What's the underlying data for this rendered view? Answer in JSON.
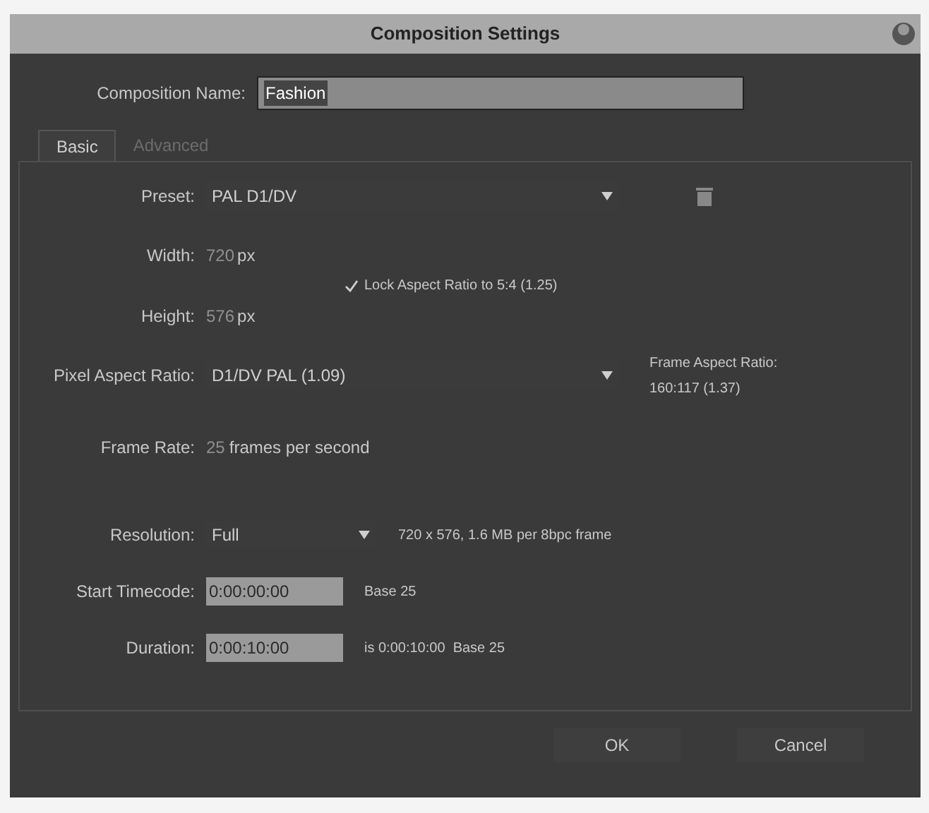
{
  "window": {
    "title": "Composition Settings"
  },
  "composition_name": {
    "label": "Composition Name:",
    "value": "Fashion"
  },
  "tabs": [
    {
      "label": "Basic",
      "selected": true
    },
    {
      "label": "Advanced",
      "selected": false
    }
  ],
  "preset": {
    "label": "Preset:",
    "value": "PAL D1/DV"
  },
  "width": {
    "label": "Width:",
    "value": "720",
    "unit": "px"
  },
  "lock_aspect": {
    "label": "Lock Aspect Ratio to 5:4 (1.25)",
    "checked": true
  },
  "height": {
    "label": "Height:",
    "value": "576",
    "unit": "px"
  },
  "pixel_aspect_ratio": {
    "label": "Pixel Aspect Ratio:",
    "value": "D1/DV PAL (1.09)",
    "frame_aspect_label": "Frame Aspect Ratio:",
    "frame_aspect_value": "160:117 (1.37)"
  },
  "frame_rate": {
    "label": "Frame Rate:",
    "value": "25",
    "unit": "frames per second"
  },
  "resolution": {
    "label": "Resolution:",
    "value": "Full",
    "info": "720 x 576, 1.6 MB per 8bpc frame"
  },
  "start_timecode": {
    "label": "Start Timecode:",
    "value": "0:00:00:00",
    "info": "Base 25"
  },
  "duration": {
    "label": "Duration:",
    "value": "0:00:10:00",
    "info": "is 0:00:10:00  Base 25"
  },
  "buttons": [
    "OK",
    "Cancel"
  ]
}
